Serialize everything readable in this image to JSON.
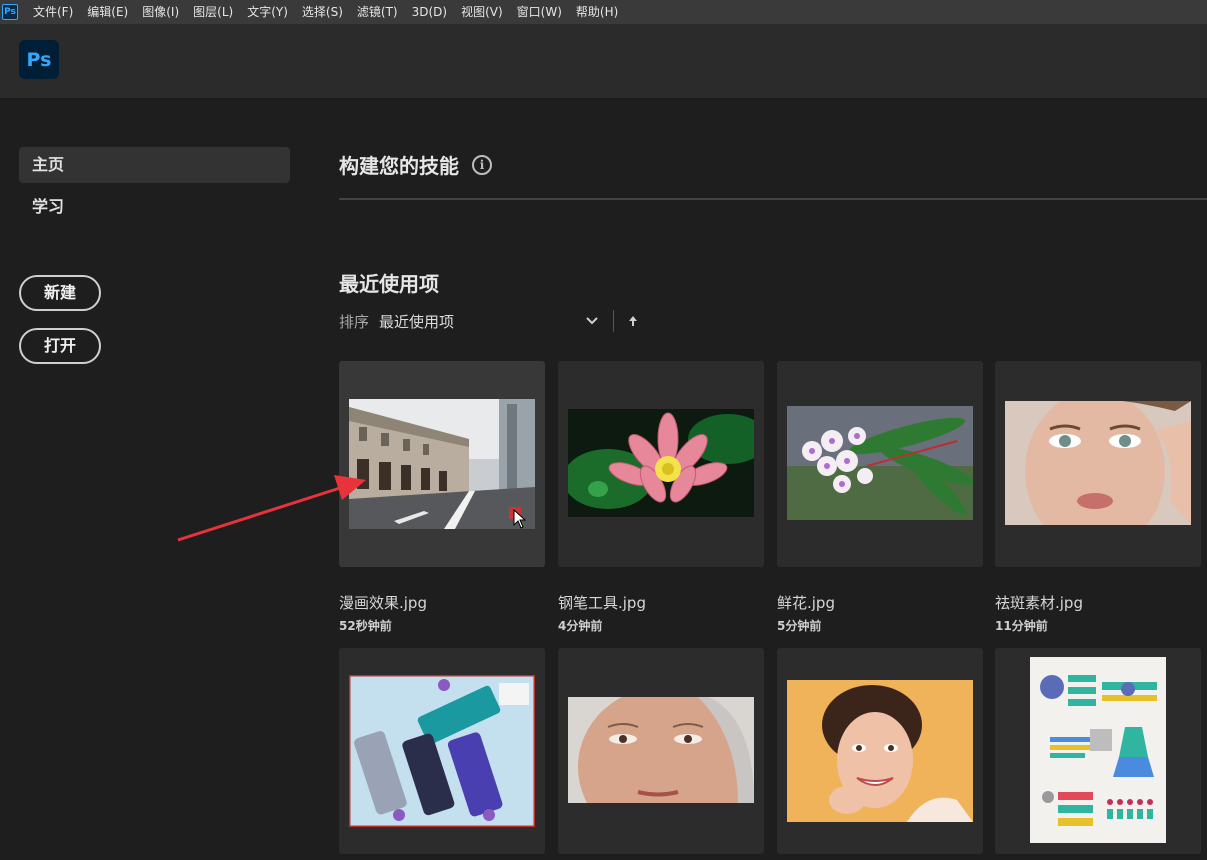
{
  "app": {
    "icon_text": "Ps",
    "logo_text": "Ps"
  },
  "menubar": {
    "items": [
      "文件(F)",
      "编辑(E)",
      "图像(I)",
      "图层(L)",
      "文字(Y)",
      "选择(S)",
      "滤镜(T)",
      "3D(D)",
      "视图(V)",
      "窗口(W)",
      "帮助(H)"
    ]
  },
  "sidebar": {
    "nav": [
      {
        "label": "主页",
        "active": true
      },
      {
        "label": "学习",
        "active": false
      }
    ],
    "new_button": "新建",
    "open_button": "打开"
  },
  "main": {
    "skills_title": "构建您的技能",
    "info_icon": "i",
    "recent_title": "最近使用项",
    "sort": {
      "label": "排序",
      "value": "最近使用项"
    }
  },
  "files": [
    {
      "name": "漫画效果.jpg",
      "time": "52秒钟前"
    },
    {
      "name": "钢笔工具.jpg",
      "time": "4分钟前"
    },
    {
      "name": "鲜花.jpg",
      "time": "5分钟前"
    },
    {
      "name": "祛斑素材.jpg",
      "time": "11分钟前"
    },
    {
      "name": "",
      "time": ""
    },
    {
      "name": "",
      "time": ""
    },
    {
      "name": "",
      "time": ""
    },
    {
      "name": "",
      "time": ""
    }
  ],
  "colors": {
    "accent": "#31a8ff",
    "annotation_arrow": "#e8333a",
    "background": "#1e1e1e"
  }
}
